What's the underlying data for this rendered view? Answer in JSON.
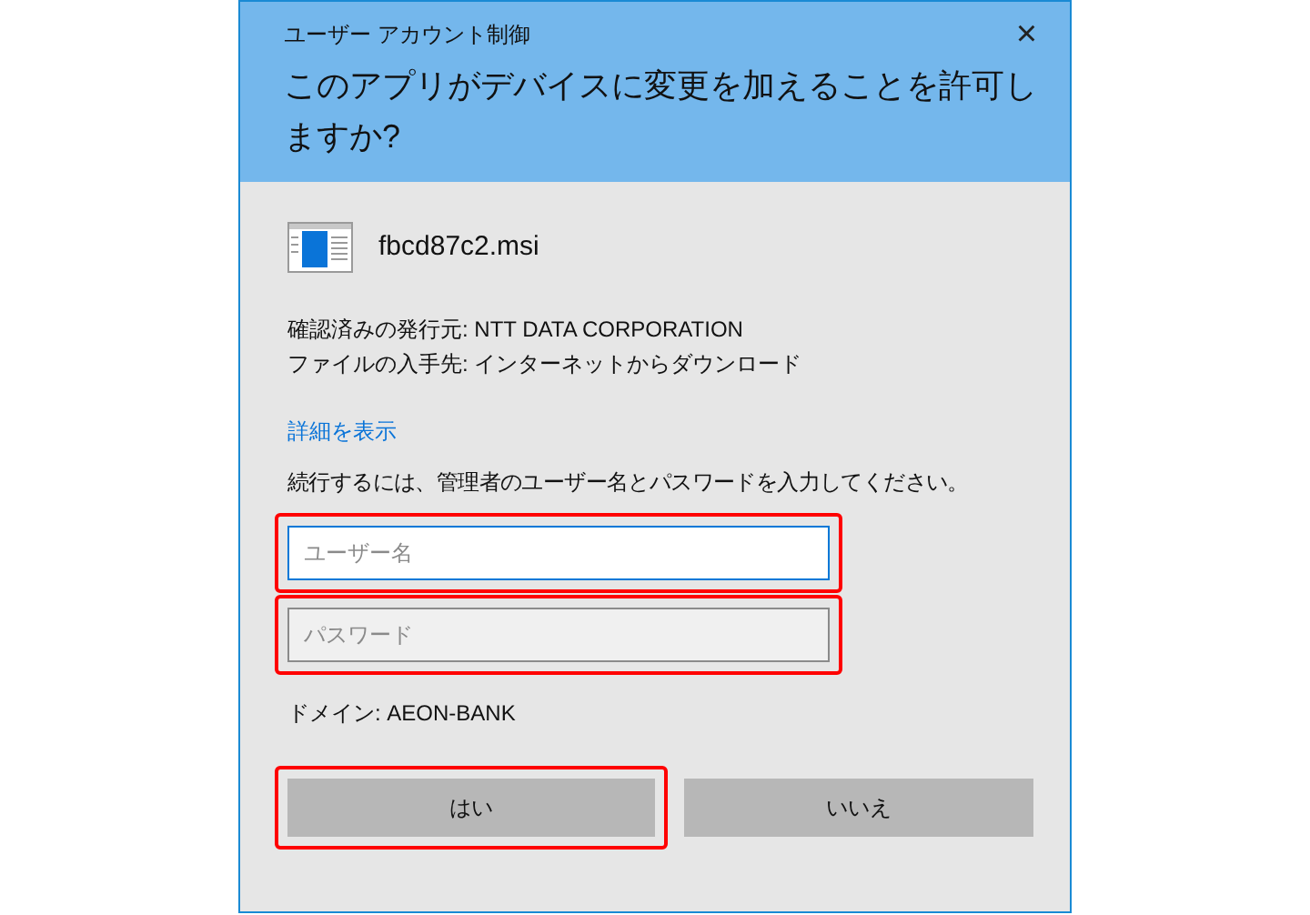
{
  "window": {
    "title": "ユーザー アカウント制御",
    "close": "×"
  },
  "question": "このアプリがデバイスに変更を加えることを許可しますか?",
  "program": {
    "name": "fbcd87c2.msi"
  },
  "details": [
    "確認済みの発行元: NTT DATA CORPORATION",
    "ファイルの入手先: インターネットからダウンロード"
  ],
  "details_link": "詳細を表示",
  "instruction": "続行するには、管理者のユーザー名とパスワードを入力してください。",
  "fields": [
    {
      "placeholder": "ユーザー名",
      "focused": true,
      "highlighted": true
    },
    {
      "placeholder": "パスワード",
      "focused": false,
      "highlighted": true
    }
  ],
  "domain": "ドメイン: AEON-BANK",
  "buttons": [
    {
      "label": "はい",
      "highlighted": true
    },
    {
      "label": "いいえ",
      "highlighted": false
    }
  ]
}
